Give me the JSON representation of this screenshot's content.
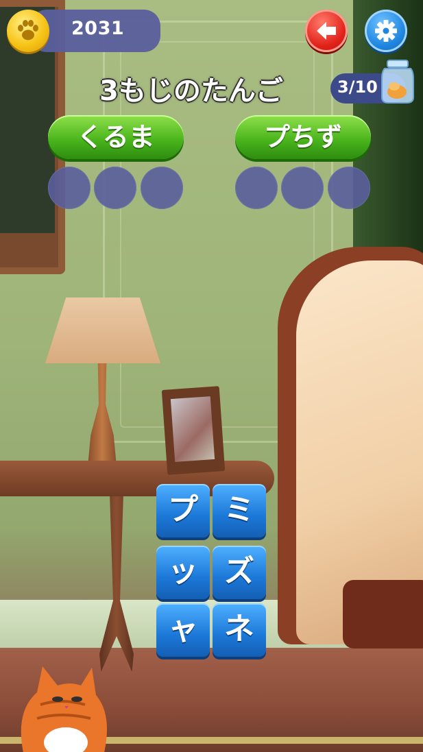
{
  "hud": {
    "coins": "2031",
    "coin_icon": "paw-coin-icon",
    "back_icon": "back-arrow-icon",
    "settings_icon": "gear-icon"
  },
  "level": {
    "title": "3もじのたんご",
    "progress_text": "3/10",
    "progress": {
      "current": 3,
      "total": 10
    },
    "jar_icon": "treat-jar-icon"
  },
  "found_words": [
    {
      "word": "くるま",
      "slots": 3
    },
    {
      "word": "プちず",
      "slots": 3
    }
  ],
  "letter_tiles": [
    {
      "char": "プ"
    },
    {
      "char": "ミ"
    },
    {
      "char": "ッ"
    },
    {
      "char": "ズ"
    },
    {
      "char": "ャ"
    },
    {
      "char": "ネ"
    }
  ],
  "colors": {
    "word_pill": "#47b21b",
    "tile": "#1c78d8",
    "slot": "#5a5f9c",
    "back_button": "#e2231a",
    "settings_button": "#1f86e0",
    "coin": "#f7c417"
  }
}
